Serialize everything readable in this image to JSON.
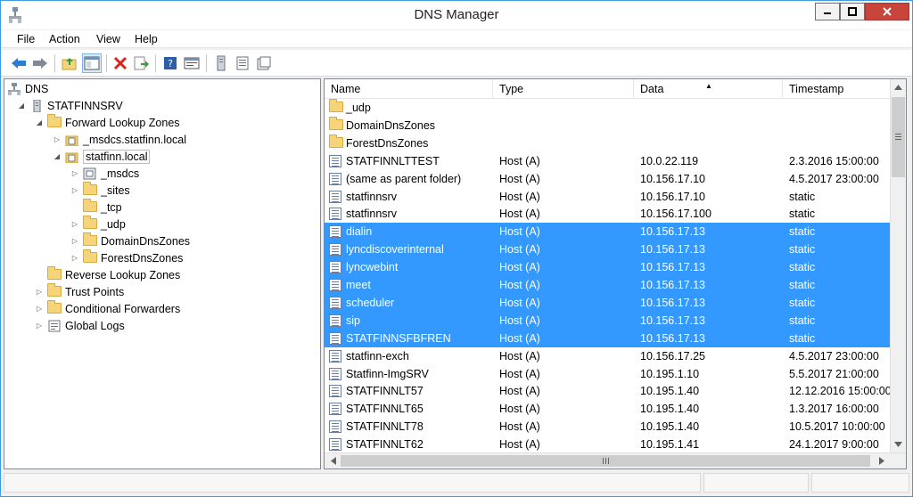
{
  "window": {
    "title": "DNS Manager"
  },
  "menubar": {
    "items": [
      "File",
      "Action",
      "View",
      "Help"
    ]
  },
  "toolbar": {
    "buttons": [
      "back-arrow-icon",
      "forward-arrow-icon",
      "up-folder-icon",
      "show-hide-tree-icon",
      "delete-icon",
      "export-list-icon",
      "help-icon",
      "properties-icon",
      "server-icon",
      "list-icon",
      "zone-icon"
    ]
  },
  "tree": {
    "items": [
      {
        "label": "DNS",
        "icon": "dns-icon",
        "expander": ""
      },
      {
        "label": "STATFINNSRV",
        "icon": "server-icon",
        "expander": "◢"
      },
      {
        "label": "Forward Lookup Zones",
        "icon": "folder-icon",
        "expander": "◢"
      },
      {
        "label": "_msdcs.statfinn.local",
        "icon": "zone-icon",
        "expander": "▷"
      },
      {
        "label": "statfinn.local",
        "icon": "zone-icon",
        "expander": "◢"
      },
      {
        "label": "_msdcs",
        "icon": "zone-icon",
        "expander": "▷"
      },
      {
        "label": "_sites",
        "icon": "folder-icon",
        "expander": "▷"
      },
      {
        "label": "_tcp",
        "icon": "folder-icon",
        "expander": ""
      },
      {
        "label": "_udp",
        "icon": "folder-icon",
        "expander": "▷"
      },
      {
        "label": "DomainDnsZones",
        "icon": "folder-icon",
        "expander": "▷"
      },
      {
        "label": "ForestDnsZones",
        "icon": "folder-icon",
        "expander": "▷"
      },
      {
        "label": "Reverse Lookup Zones",
        "icon": "folder-icon",
        "expander": ""
      },
      {
        "label": "Trust Points",
        "icon": "folder-icon",
        "expander": "▷"
      },
      {
        "label": "Conditional Forwarders",
        "icon": "folder-icon",
        "expander": "▷"
      },
      {
        "label": "Global Logs",
        "icon": "log-icon",
        "expander": "▷"
      }
    ]
  },
  "list": {
    "columns": [
      "Name",
      "Type",
      "Data",
      "Timestamp"
    ],
    "sort_indicator": "▲",
    "rows": [
      {
        "name": "_udp",
        "type": "",
        "data": "",
        "timestamp": "",
        "icon": "folder",
        "selected": false
      },
      {
        "name": "DomainDnsZones",
        "type": "",
        "data": "",
        "timestamp": "",
        "icon": "folder",
        "selected": false
      },
      {
        "name": "ForestDnsZones",
        "type": "",
        "data": "",
        "timestamp": "",
        "icon": "folder",
        "selected": false
      },
      {
        "name": "STATFINNLTTEST",
        "type": "Host (A)",
        "data": "10.0.22.119",
        "timestamp": "2.3.2016 15:00:00",
        "icon": "record",
        "selected": false
      },
      {
        "name": "(same as parent folder)",
        "type": "Host (A)",
        "data": "10.156.17.10",
        "timestamp": "4.5.2017 23:00:00",
        "icon": "record",
        "selected": false
      },
      {
        "name": "statfinnsrv",
        "type": "Host (A)",
        "data": "10.156.17.10",
        "timestamp": "static",
        "icon": "record",
        "selected": false
      },
      {
        "name": "statfinnsrv",
        "type": "Host (A)",
        "data": "10.156.17.100",
        "timestamp": "static",
        "icon": "record",
        "selected": false
      },
      {
        "name": "dialin",
        "type": "Host (A)",
        "data": "10.156.17.13",
        "timestamp": "static",
        "icon": "record",
        "selected": true
      },
      {
        "name": "lyncdiscoverinternal",
        "type": "Host (A)",
        "data": "10.156.17.13",
        "timestamp": "static",
        "icon": "record",
        "selected": true
      },
      {
        "name": "lyncwebint",
        "type": "Host (A)",
        "data": "10.156.17.13",
        "timestamp": "static",
        "icon": "record",
        "selected": true
      },
      {
        "name": "meet",
        "type": "Host (A)",
        "data": "10.156.17.13",
        "timestamp": "static",
        "icon": "record",
        "selected": true
      },
      {
        "name": "scheduler",
        "type": "Host (A)",
        "data": "10.156.17.13",
        "timestamp": "static",
        "icon": "record",
        "selected": true
      },
      {
        "name": "sip",
        "type": "Host (A)",
        "data": "10.156.17.13",
        "timestamp": "static",
        "icon": "record",
        "selected": true
      },
      {
        "name": "STATFINNSFBFREN",
        "type": "Host (A)",
        "data": "10.156.17.13",
        "timestamp": "static",
        "icon": "record",
        "selected": true
      },
      {
        "name": "statfinn-exch",
        "type": "Host (A)",
        "data": "10.156.17.25",
        "timestamp": "4.5.2017 23:00:00",
        "icon": "record",
        "selected": false
      },
      {
        "name": "Statfinn-ImgSRV",
        "type": "Host (A)",
        "data": "10.195.1.10",
        "timestamp": "5.5.2017 21:00:00",
        "icon": "record",
        "selected": false
      },
      {
        "name": "STATFINNLT57",
        "type": "Host (A)",
        "data": "10.195.1.40",
        "timestamp": "12.12.2016 15:00:00",
        "icon": "record",
        "selected": false
      },
      {
        "name": "STATFINNLT65",
        "type": "Host (A)",
        "data": "10.195.1.40",
        "timestamp": "1.3.2017 16:00:00",
        "icon": "record",
        "selected": false
      },
      {
        "name": "STATFINNLT78",
        "type": "Host (A)",
        "data": "10.195.1.40",
        "timestamp": "10.5.2017 10:00:00",
        "icon": "record",
        "selected": false
      },
      {
        "name": "STATFINNLT62",
        "type": "Host (A)",
        "data": "10.195.1.41",
        "timestamp": "24.1.2017 9:00:00",
        "icon": "record",
        "selected": false
      }
    ]
  },
  "colors": {
    "selection": "#3399ff",
    "title_close": "#c7453b"
  }
}
